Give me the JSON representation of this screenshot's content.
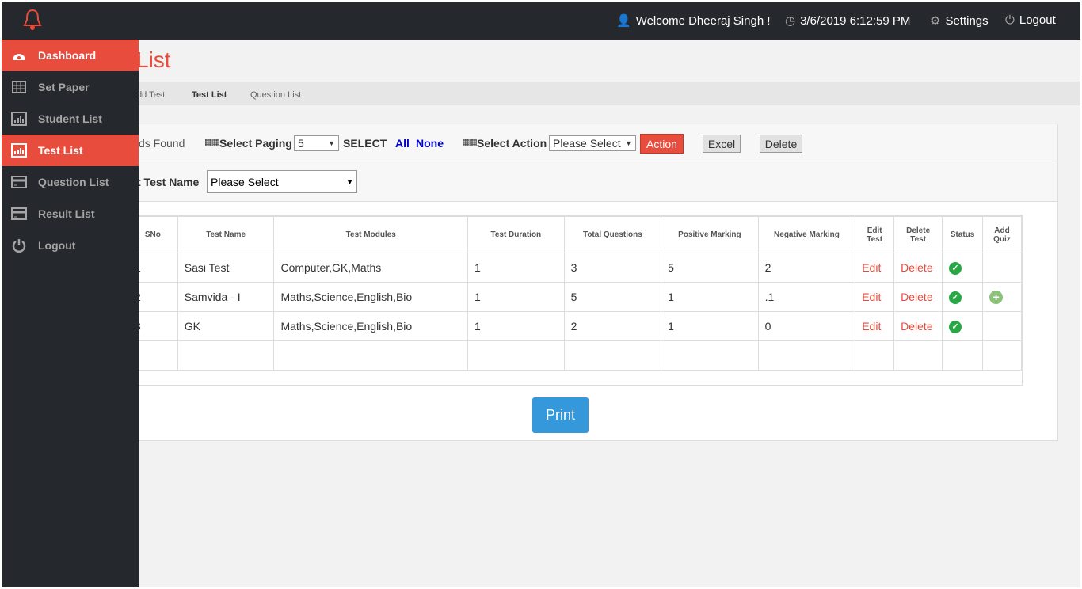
{
  "header": {
    "welcome": "Welcome Dheeraj Singh !",
    "datetime": "3/6/2019 6:12:59 PM",
    "settings": "Settings",
    "logout": "Logout"
  },
  "sidebar": {
    "items": [
      {
        "label": "Dashboard",
        "icon": "dashboard-icon",
        "active": true
      },
      {
        "label": "Set Paper",
        "icon": "table-icon",
        "active": false
      },
      {
        "label": "Student List",
        "icon": "bar-chart-icon",
        "active": false
      },
      {
        "label": "Test List",
        "icon": "bar-chart-icon",
        "active": true
      },
      {
        "label": "Question List",
        "icon": "card-icon",
        "active": false
      },
      {
        "label": "Result List",
        "icon": "card-icon",
        "active": false
      },
      {
        "label": "Logout",
        "icon": "power-icon",
        "active": false
      }
    ]
  },
  "page": {
    "title": "List",
    "tabs": [
      "dd Test",
      "Test List",
      "Question List"
    ]
  },
  "toolbar": {
    "records": "ds Found",
    "select_paging": "Select Paging",
    "paging_value": "5",
    "select": "SELECT",
    "all": "All",
    "none": "None",
    "select_action": "Select Action",
    "action_value": "Please Select",
    "action": "Action",
    "excel": "Excel",
    "delete": "Delete"
  },
  "filter": {
    "label": "t Test Name",
    "value": "Please Select"
  },
  "table": {
    "headers": [
      "SNo",
      "Test Name",
      "Test Modules",
      "Test Duration",
      "Total Questions",
      "Positive Marking",
      "Negative Marking",
      "Edit Test",
      "Delete Test",
      "Status",
      "Add Quiz"
    ],
    "rows": [
      {
        "sno": "1",
        "name": "Sasi Test",
        "modules": "Computer,GK,Maths",
        "duration": "1",
        "questions": "3",
        "positive": "5",
        "negative": "2",
        "edit": "Edit",
        "delete": "Delete",
        "status": "active",
        "add_quiz": false
      },
      {
        "sno": "2",
        "name": "Samvida - I",
        "modules": "Maths,Science,English,Bio",
        "duration": "1",
        "questions": "5",
        "positive": "1",
        "negative": ".1",
        "edit": "Edit",
        "delete": "Delete",
        "status": "active",
        "add_quiz": true
      },
      {
        "sno": "3",
        "name": "GK",
        "modules": "Maths,Science,English,Bio",
        "duration": "1",
        "questions": "2",
        "positive": "1",
        "negative": "0",
        "edit": "Edit",
        "delete": "Delete",
        "status": "active",
        "add_quiz": false
      }
    ]
  },
  "print": "Print",
  "colors": {
    "accent": "#e74c3c",
    "dark": "#25282c",
    "print": "#3498db",
    "link": "#0000cc"
  }
}
